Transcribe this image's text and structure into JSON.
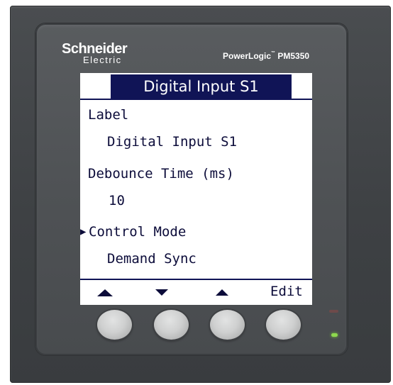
{
  "brand": {
    "name": "Schneider",
    "sub": "Electric",
    "model": "PowerLogic",
    "model_tm": "™",
    "model_number": "PM5350"
  },
  "screen": {
    "title": "Digital Input S1",
    "items": [
      {
        "label": "Label"
      },
      {
        "value": "Digital Input S1"
      },
      {
        "label": "Debounce Time (ms)"
      },
      {
        "value": "10"
      },
      {
        "label": "Control Mode",
        "selected": true
      },
      {
        "value": "Demand Sync"
      }
    ],
    "cursor_glyph": "▶",
    "softkeys": [
      {
        "icon": "up-arrow-icon"
      },
      {
        "icon": "down-arrow-icon"
      },
      {
        "icon": "up-arrow-small-icon"
      },
      {
        "label": "Edit"
      }
    ]
  },
  "leds": {
    "red_color": "#6e4a4a",
    "green_color": "#8dd94e"
  }
}
